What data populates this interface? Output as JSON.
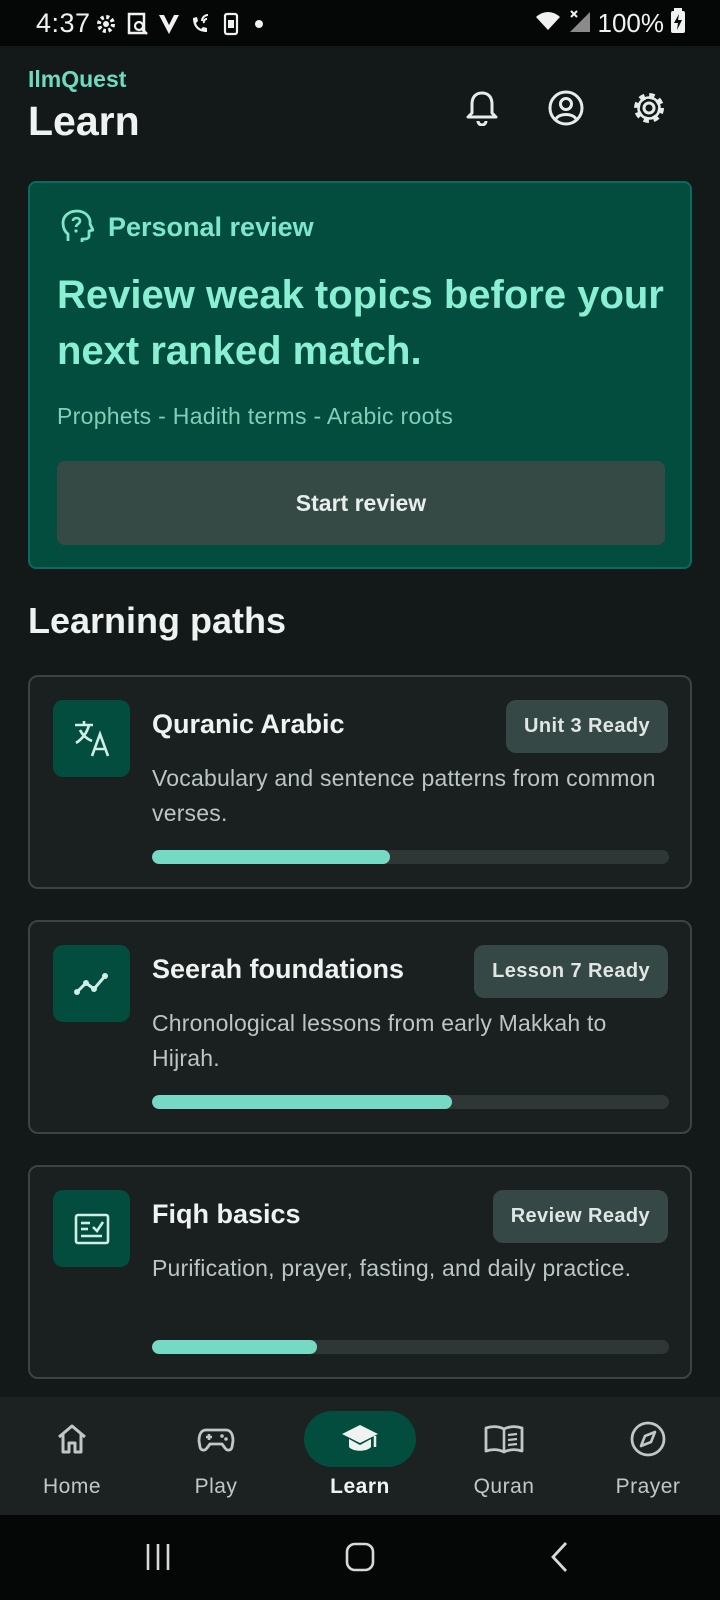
{
  "status_bar": {
    "time": "4:37",
    "battery": "100%",
    "icons": [
      "settings-icon",
      "screen-search-icon",
      "v-icon",
      "wifi-call-icon",
      "phone-icon",
      "dot-icon",
      "wifi-icon",
      "signal-icon",
      "battery-charging-icon"
    ]
  },
  "header": {
    "app_name": "IlmQuest",
    "title": "Learn",
    "actions": [
      "bell-icon",
      "account-icon",
      "gear-icon"
    ]
  },
  "review_card": {
    "label": "Personal review",
    "icon": "head-question-icon",
    "headline": "Review weak topics before your next ranked match.",
    "topics": "Prophets - Hadith terms - Arabic roots",
    "button_label": "Start review"
  },
  "learning_paths": {
    "title": "Learning paths",
    "items": [
      {
        "title": "Quranic Arabic",
        "badge": "Unit 3 Ready",
        "description": "Vocabulary and sentence patterns from common verses.",
        "progress": 0.46,
        "icon": "translate-icon"
      },
      {
        "title": "Seerah foundations",
        "badge": "Lesson 7 Ready",
        "description": "Chronological lessons from early Makkah to Hijrah.",
        "progress": 0.58,
        "icon": "timeline-icon"
      },
      {
        "title": "Fiqh basics",
        "badge": "Review Ready",
        "description": "Purification, prayer, fasting, and daily practice.",
        "progress": 0.32,
        "icon": "checklist-icon"
      }
    ]
  },
  "bottom_nav": {
    "active": "Learn",
    "items": [
      {
        "label": "Home",
        "icon": "home-icon"
      },
      {
        "label": "Play",
        "icon": "gamepad-icon"
      },
      {
        "label": "Learn",
        "icon": "graduation-cap-icon"
      },
      {
        "label": "Quran",
        "icon": "open-book-icon"
      },
      {
        "label": "Prayer",
        "icon": "compass-icon"
      }
    ]
  },
  "colors": {
    "background": "#131918",
    "accent": "#76d9c3",
    "card_green": "#034d3e",
    "card_dark": "#1a2020"
  }
}
